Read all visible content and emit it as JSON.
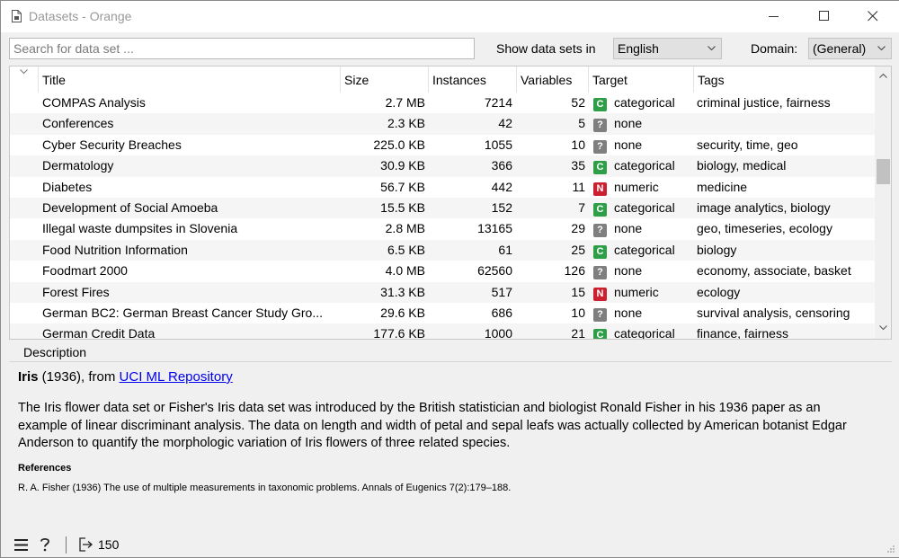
{
  "window": {
    "title": "Datasets - Orange",
    "icon": "document-icon"
  },
  "toolbar": {
    "search_placeholder": "Search for data set ...",
    "show_label": "Show data sets in",
    "language_value": "English",
    "domain_label": "Domain:",
    "domain_value": "(General)"
  },
  "table": {
    "columns": [
      "Title",
      "Size",
      "Instances",
      "Variables",
      "Target",
      "Tags"
    ],
    "rows": [
      {
        "title": "COMPAS Analysis",
        "size": "2.7 MB",
        "instances": "7214",
        "variables": "52",
        "badge": "C",
        "target": "categorical",
        "tags": "criminal justice, fairness"
      },
      {
        "title": "Conferences",
        "size": "2.3 KB",
        "instances": "42",
        "variables": "5",
        "badge": "?",
        "target": "none",
        "tags": ""
      },
      {
        "title": "Cyber Security Breaches",
        "size": "225.0 KB",
        "instances": "1055",
        "variables": "10",
        "badge": "?",
        "target": "none",
        "tags": "security, time, geo"
      },
      {
        "title": "Dermatology",
        "size": "30.9 KB",
        "instances": "366",
        "variables": "35",
        "badge": "C",
        "target": "categorical",
        "tags": "biology, medical"
      },
      {
        "title": "Diabetes",
        "size": "56.7 KB",
        "instances": "442",
        "variables": "11",
        "badge": "N",
        "target": "numeric",
        "tags": "medicine"
      },
      {
        "title": "Development of Social Amoeba",
        "size": "15.5 KB",
        "instances": "152",
        "variables": "7",
        "badge": "C",
        "target": "categorical",
        "tags": "image analytics, biology"
      },
      {
        "title": "Illegal waste dumpsites in Slovenia",
        "size": "2.8 MB",
        "instances": "13165",
        "variables": "29",
        "badge": "?",
        "target": "none",
        "tags": "geo, timeseries, ecology"
      },
      {
        "title": "Food Nutrition Information",
        "size": "6.5 KB",
        "instances": "61",
        "variables": "25",
        "badge": "C",
        "target": "categorical",
        "tags": "biology"
      },
      {
        "title": "Foodmart 2000",
        "size": "4.0 MB",
        "instances": "62560",
        "variables": "126",
        "badge": "?",
        "target": "none",
        "tags": "economy, associate, basket"
      },
      {
        "title": "Forest Fires",
        "size": "31.3 KB",
        "instances": "517",
        "variables": "15",
        "badge": "N",
        "target": "numeric",
        "tags": "ecology"
      },
      {
        "title": "German BC2: German Breast Cancer Study Gro...",
        "size": "29.6 KB",
        "instances": "686",
        "variables": "10",
        "badge": "?",
        "target": "none",
        "tags": "survival analysis, censoring"
      },
      {
        "title": "German Credit Data",
        "size": "177.6 KB",
        "instances": "1000",
        "variables": "21",
        "badge": "C",
        "target": "categorical",
        "tags": "finance, fairness"
      }
    ]
  },
  "description": {
    "section_label": "Description",
    "name": "Iris",
    "year_from": " (1936), from ",
    "source_link": "UCI ML Repository",
    "text": "The Iris flower data set or Fisher's Iris data set was introduced by the British statistician and biologist Ronald Fisher in his 1936 paper as an example of linear discriminant analysis. The data on length and width of petal and sepal leafs was actually collected by American botanist Edgar Anderson to quantify the morphologic variation of Iris flowers of three related species.",
    "references_label": "References",
    "references_text": "R. A. Fisher (1936) The use of multiple measurements in taxonomic problems. Annals of Eugenics 7(2):179–188."
  },
  "status": {
    "output_count": "150"
  },
  "colors": {
    "categorical": "#2e9f47",
    "numeric": "#cc1f2f",
    "none": "#7f7f7f",
    "link": "#0000ee"
  }
}
